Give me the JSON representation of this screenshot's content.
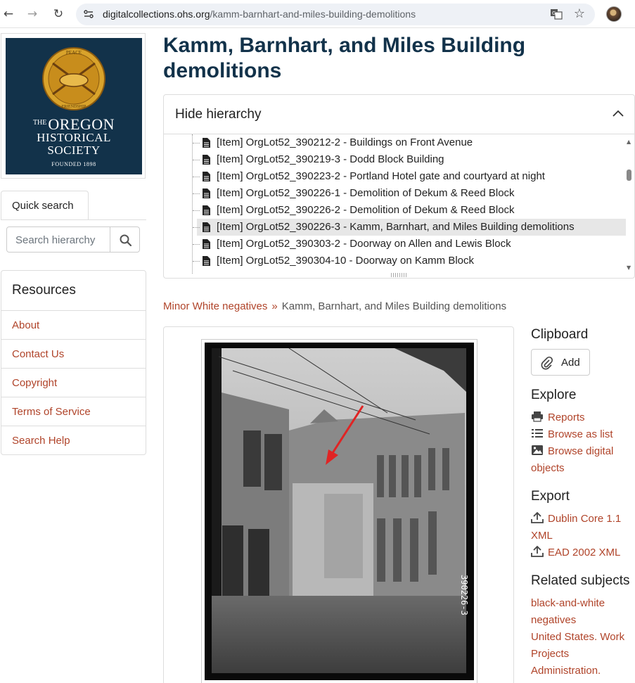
{
  "browser": {
    "url_host": "digitalcollections.ohs.org",
    "url_path": "/kamm-barnhart-and-miles-building-demolitions"
  },
  "logo": {
    "the": "THE",
    "line1": "OREGON",
    "line2": "HISTORICAL",
    "line3": "SOCIETY",
    "founded": "FOUNDED 1898",
    "seal_top": "PEACE",
    "seal_bottom": "FRIENDSHIP"
  },
  "quick_search": {
    "tab_label": "Quick search",
    "placeholder": "Search hierarchy"
  },
  "resources": {
    "heading": "Resources",
    "items": [
      "About",
      "Contact Us",
      "Copyright",
      "Terms of Service",
      "Search Help"
    ]
  },
  "page": {
    "title_line1": "Kamm, Barnhart, and Miles Building",
    "title_line2": "demolitions"
  },
  "hierarchy": {
    "toggle_label": "Hide hierarchy",
    "items": [
      {
        "label": "[Item] OrgLot52_390212-2 - Buildings on Front Avenue",
        "selected": false
      },
      {
        "label": "[Item] OrgLot52_390219-3 - Dodd Block Building",
        "selected": false
      },
      {
        "label": "[Item] OrgLot52_390223-2 - Portland Hotel gate and courtyard at night",
        "selected": false
      },
      {
        "label": "[Item] OrgLot52_390226-1 - Demolition of Dekum & Reed Block",
        "selected": false
      },
      {
        "label": "[Item] OrgLot52_390226-2 - Demolition of Dekum & Reed Block",
        "selected": false
      },
      {
        "label": "[Item] OrgLot52_390226-3 - Kamm, Barnhart, and Miles Building demolitions",
        "selected": true
      },
      {
        "label": "[Item] OrgLot52_390303-2 - Doorway on Allen and Lewis Block",
        "selected": false
      },
      {
        "label": "[Item] OrgLot52_390304-10 - Doorway on Kamm Block",
        "selected": false
      }
    ]
  },
  "breadcrumb": {
    "parent": "Minor White negatives",
    "separator": "»",
    "current": "Kamm, Barnhart, and Miles Building demolitions"
  },
  "photo": {
    "negative_number": "390226-3"
  },
  "clipboard": {
    "heading": "Clipboard",
    "add_label": "Add"
  },
  "explore": {
    "heading": "Explore",
    "reports": "Reports",
    "browse_list": "Browse as list",
    "browse_digital_1": "Browse digital",
    "browse_digital_2": "objects"
  },
  "export": {
    "heading": "Export",
    "dc_1": "Dublin Core 1.1",
    "dc_2": "XML",
    "ead": "EAD 2002 XML"
  },
  "related_subjects": {
    "heading": "Related subjects",
    "lines": [
      "black-and-white",
      "negatives",
      "United States. Work",
      "Projects",
      "Administration."
    ]
  },
  "colors": {
    "title": "#12324a",
    "link": "#b0442a",
    "logo_bg": "#12324a"
  }
}
